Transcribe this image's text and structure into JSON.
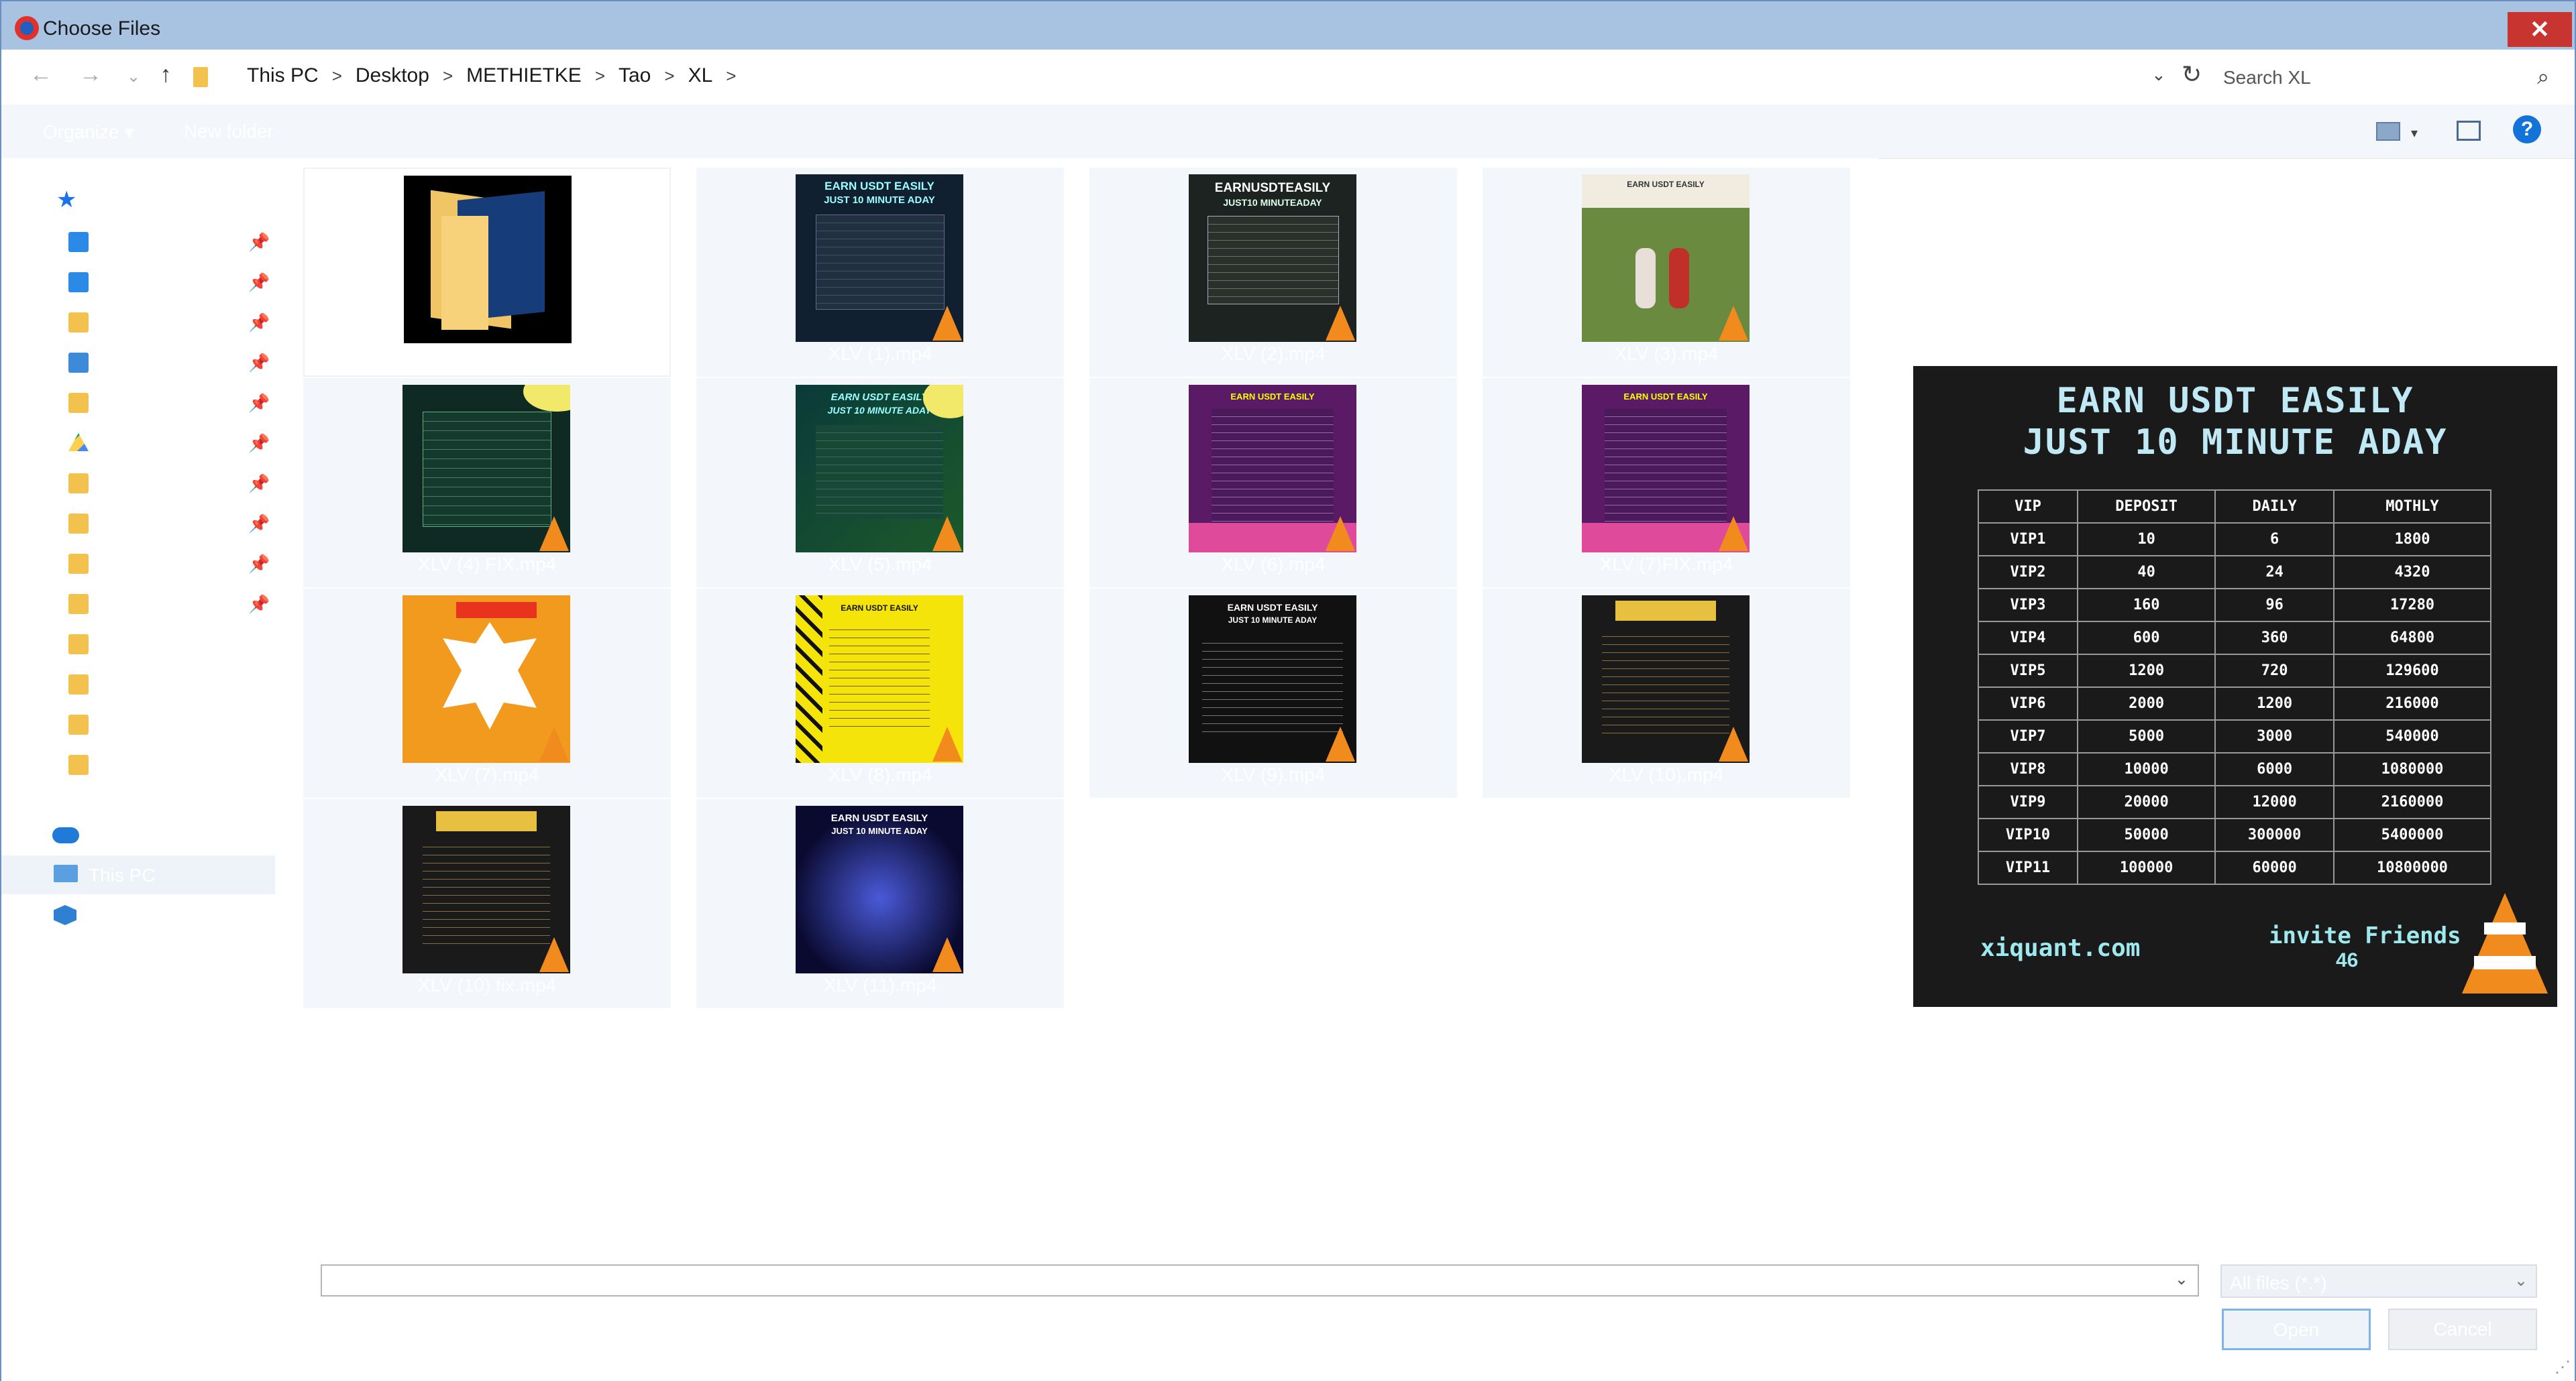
{
  "window": {
    "title": "Choose Files",
    "close_label": "✕"
  },
  "address": {
    "crumbs": [
      "This PC",
      "Desktop",
      "METHIETKE",
      "Tao",
      "XL"
    ],
    "search_placeholder": "Search XL"
  },
  "toolbar": {
    "organize": "Organize ▾",
    "new_folder": "New folder",
    "help": "?"
  },
  "files": [
    {
      "label": ""
    },
    {
      "label": "XLV (1).mp4"
    },
    {
      "label": "XLV (2).mp4"
    },
    {
      "label": "XLV (3).mp4"
    },
    {
      "label": "XLV (4) FIX.mp4"
    },
    {
      "label": "XLV (5).mp4"
    },
    {
      "label": "XLV (6).mp4"
    },
    {
      "label": "XLV (7)FIX.mp4"
    },
    {
      "label": "XLV (7).mp4"
    },
    {
      "label": "XLV (8).mp4"
    },
    {
      "label": "XLV (9).mp4"
    },
    {
      "label": "XLV (10).mp4"
    },
    {
      "label": "XLV (10) fix.mp4"
    },
    {
      "label": "XLV (11).mp4"
    }
  ],
  "nav": {
    "this_pc": "This PC"
  },
  "preview": {
    "title_line1": "EARN USDT EASILY",
    "title_line2": "JUST 10 MINUTE ADAY",
    "headers": [
      "VIP",
      "DEPOSIT",
      "DAILY",
      "MOTHLY"
    ],
    "rows": [
      [
        "VIP1",
        "10",
        "6",
        "1800"
      ],
      [
        "VIP2",
        "40",
        "24",
        "4320"
      ],
      [
        "VIP3",
        "160",
        "96",
        "17280"
      ],
      [
        "VIP4",
        "600",
        "360",
        "64800"
      ],
      [
        "VIP5",
        "1200",
        "720",
        "129600"
      ],
      [
        "VIP6",
        "2000",
        "1200",
        "216000"
      ],
      [
        "VIP7",
        "5000",
        "3000",
        "540000"
      ],
      [
        "VIP8",
        "10000",
        "6000",
        "1080000"
      ],
      [
        "VIP9",
        "20000",
        "12000",
        "2160000"
      ],
      [
        "VIP10",
        "50000",
        "300000",
        "5400000"
      ],
      [
        "VIP11",
        "100000",
        "60000",
        "10800000"
      ]
    ],
    "footer_left": "xiquant.com",
    "footer_right1": "invite Friends",
    "footer_right2": "46"
  },
  "bottom": {
    "file_name_value": "",
    "file_type": "All files (*.*)",
    "open_label": "Open",
    "cancel_label": "Cancel"
  }
}
